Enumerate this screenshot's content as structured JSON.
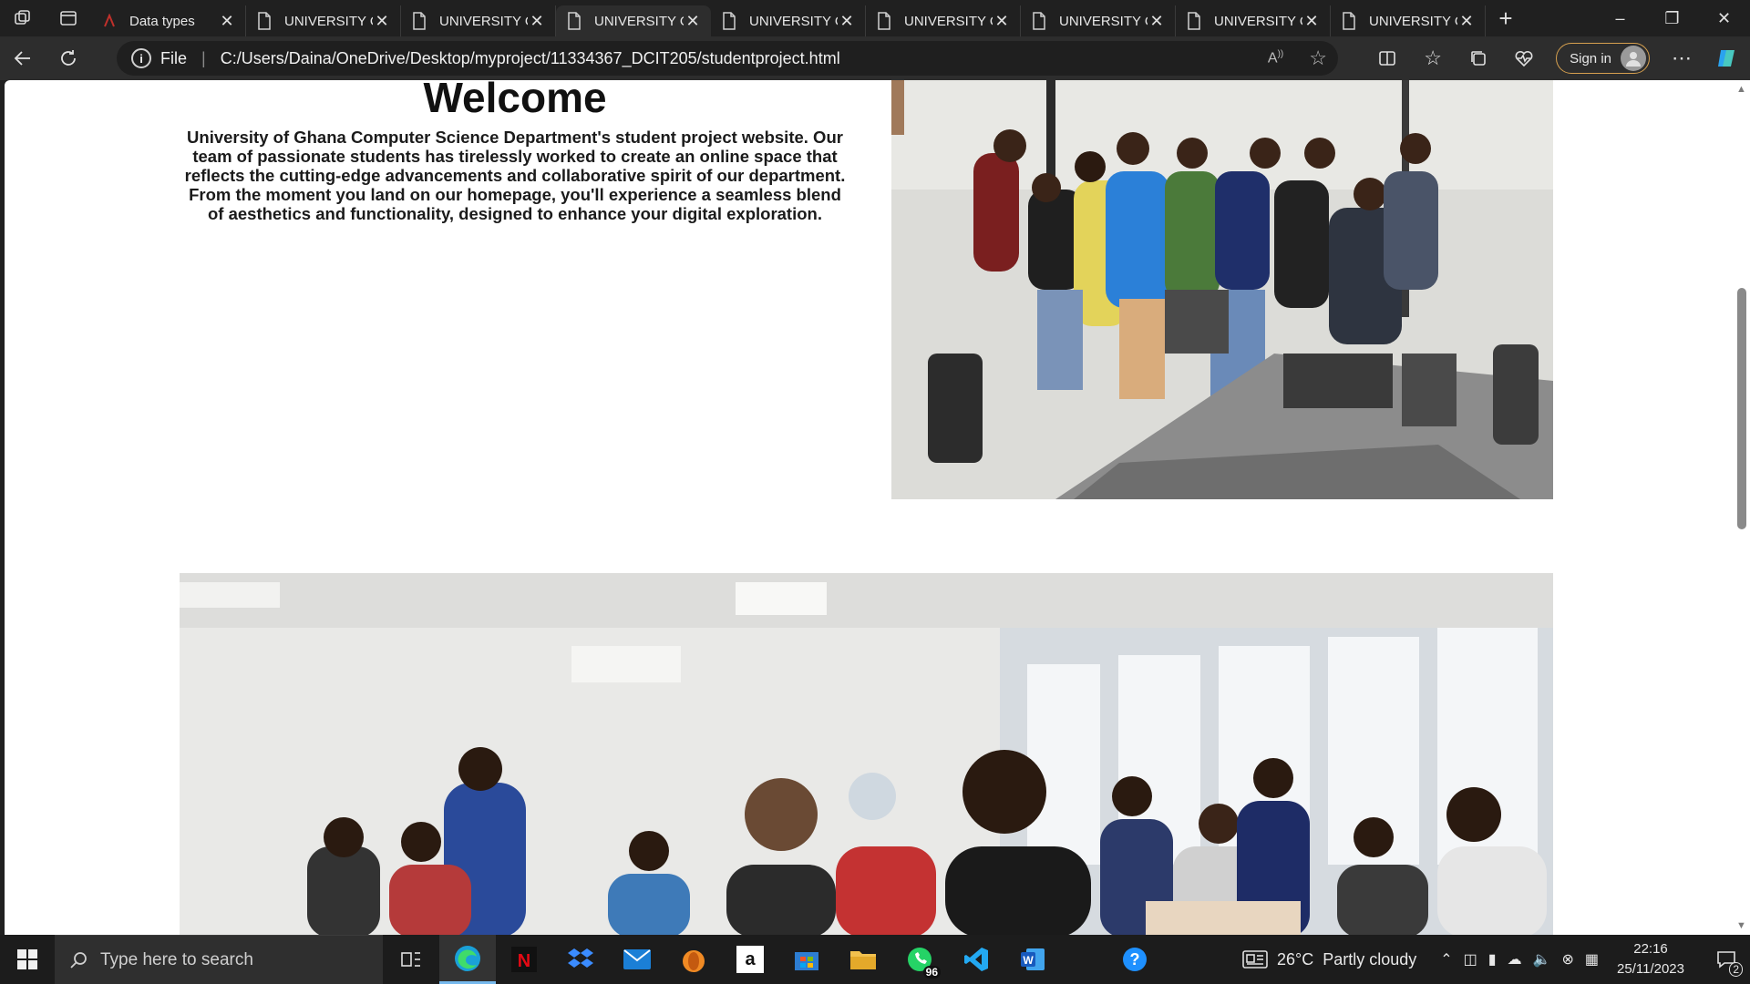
{
  "tabs": [
    {
      "title": "Data types",
      "icon": "ask-icon",
      "active": false
    },
    {
      "title": "UNIVERSITY OF GHANA",
      "active": false
    },
    {
      "title": "UNIVERSITY OF GHANA",
      "active": false
    },
    {
      "title": "UNIVERSITY OF GHANA",
      "active": true
    },
    {
      "title": "UNIVERSITY OF GHANA",
      "active": false
    },
    {
      "title": "UNIVERSITY OF GHANA",
      "active": false
    },
    {
      "title": "UNIVERSITY OF GHANA",
      "active": false
    },
    {
      "title": "UNIVERSITY OF GHANA",
      "active": false
    },
    {
      "title": "UNIVERSITY OF GHANA",
      "active": false
    }
  ],
  "address": {
    "scheme_label": "File",
    "url": "C:/Users/Daina/OneDrive/Desktop/myproject/11334367_DCIT205/studentproject.html"
  },
  "toolbar": {
    "signin_label": "Sign in"
  },
  "page": {
    "heading": "Welcome",
    "intro": "University of Ghana Computer Science Department's student project website. Our team of passionate students has tirelessly worked to create an online space that reflects the cutting-edge advancements and collaborative spirit of our department. From the moment you land on our homepage, you'll experience a seamless blend of aesthetics and functionality, designed to enhance your digital exploration.",
    "photo1_alt": "Group of students posing in a computer lab",
    "photo2_alt": "Students seated in a computer lab classroom"
  },
  "taskbar": {
    "search_placeholder": "Type here to search",
    "whatsapp_badge": "96",
    "weather_temp": "26°C",
    "weather_desc": "Partly cloudy",
    "time": "22:16",
    "date": "25/11/2023",
    "notifications": "2"
  },
  "colors": {
    "accent": "#76b9ed",
    "signin_border": "#d6a04f"
  }
}
